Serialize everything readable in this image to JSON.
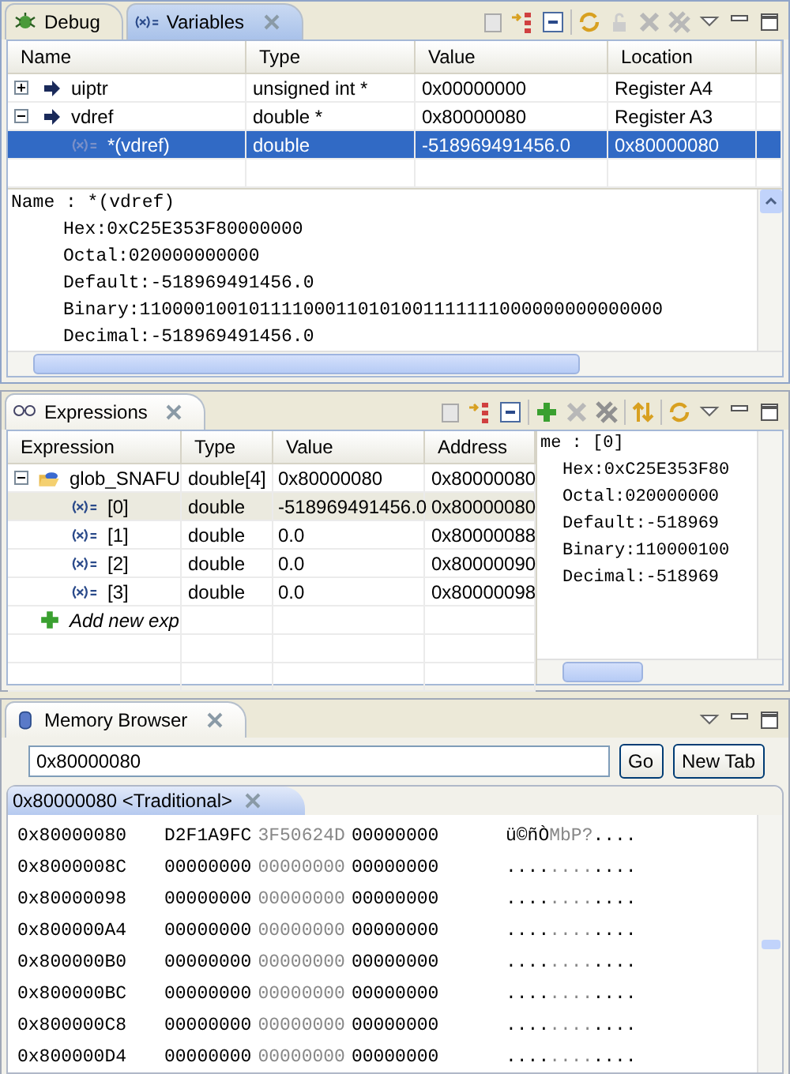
{
  "top_panel": {
    "tabs": [
      {
        "label": "Debug",
        "selected": false,
        "closable": false
      },
      {
        "label": "Variables",
        "selected": true,
        "closable": true
      }
    ]
  },
  "variables": {
    "columns": [
      "Name",
      "Type",
      "Value",
      "Location"
    ],
    "rows": [
      {
        "kind": "pointer",
        "name": "uiptr",
        "type": "unsigned int *",
        "value": "0x00000000",
        "location": "Register A4",
        "expanded": false,
        "selected": false
      },
      {
        "kind": "pointer",
        "name": "vdref",
        "type": "double *",
        "value": "0x80000080",
        "location": "Register A3",
        "expanded": true,
        "selected": false,
        "children": [
          {
            "kind": "variable",
            "name": "*(vdref)",
            "type": "double",
            "value": "-518969491456.0",
            "location": "0x80000080",
            "selected": true
          }
        ]
      }
    ],
    "detail": {
      "name_line": "Name : *(vdref)",
      "lines": [
        "Hex:0xC25E353F80000000",
        "Octal:020000000000",
        "Default:-518969491456.0",
        "Binary:110000100101111000110101001111111000000000000000",
        "Decimal:-518969491456.0"
      ]
    }
  },
  "expressions_panel": {
    "tabs": [
      {
        "label": "Expressions",
        "selected": true,
        "closable": true
      }
    ]
  },
  "expressions": {
    "columns": [
      "Expression",
      "Type",
      "Value",
      "Address"
    ],
    "rows": [
      {
        "kind": "folder",
        "name": "glob_SNAFU",
        "type": "double[4]",
        "value": "0x80000080",
        "location": "0x80000080",
        "expanded": true,
        "selected": false,
        "children": [
          {
            "kind": "variable",
            "name": "[0]",
            "type": "double",
            "value": "-518969491456.0",
            "location": "0x80000080",
            "selected": true
          },
          {
            "kind": "variable",
            "name": "[1]",
            "type": "double",
            "value": "0.0",
            "location": "0x80000088",
            "selected": false
          },
          {
            "kind": "variable",
            "name": "[2]",
            "type": "double",
            "value": "0.0",
            "location": "0x80000090",
            "selected": false
          },
          {
            "kind": "variable",
            "name": "[3]",
            "type": "double",
            "value": "0.0",
            "location": "0x80000098",
            "selected": false
          }
        ]
      }
    ],
    "add_row": "Add new exp",
    "detail": {
      "name_line": "me : [0]",
      "lines": [
        "Hex:0xC25E353F80",
        "Octal:020000000",
        "Default:-518969",
        "Binary:110000100",
        "Decimal:-518969"
      ]
    }
  },
  "memory_panel": {
    "tabs": [
      {
        "label": "Memory Browser",
        "selected": true,
        "closable": true
      }
    ]
  },
  "memory": {
    "address_value": "0x80000080",
    "go_button": "Go",
    "new_tab_button": "New Tab",
    "rendering_tab": {
      "label": "0x80000080 <Traditional>",
      "selected": true
    },
    "rows": [
      {
        "address": "0x80000080",
        "words": [
          "D2F1A9FC",
          "3F50624D",
          "00000000"
        ],
        "ascii": [
          "ü©ñÒ",
          "MbP?",
          "...."
        ]
      },
      {
        "address": "0x8000008C",
        "words": [
          "00000000",
          "00000000",
          "00000000"
        ],
        "ascii": [
          "....",
          "....",
          "...."
        ]
      },
      {
        "address": "0x80000098",
        "words": [
          "00000000",
          "00000000",
          "00000000"
        ],
        "ascii": [
          "....",
          "....",
          "...."
        ]
      },
      {
        "address": "0x800000A4",
        "words": [
          "00000000",
          "00000000",
          "00000000"
        ],
        "ascii": [
          "....",
          "....",
          "...."
        ]
      },
      {
        "address": "0x800000B0",
        "words": [
          "00000000",
          "00000000",
          "00000000"
        ],
        "ascii": [
          "....",
          "....",
          "...."
        ]
      },
      {
        "address": "0x800000BC",
        "words": [
          "00000000",
          "00000000",
          "00000000"
        ],
        "ascii": [
          "....",
          "....",
          "...."
        ]
      },
      {
        "address": "0x800000C8",
        "words": [
          "00000000",
          "00000000",
          "00000000"
        ],
        "ascii": [
          "....",
          "....",
          "...."
        ]
      },
      {
        "address": "0x800000D4",
        "words": [
          "00000000",
          "00000000",
          "00000000"
        ],
        "ascii": [
          "....",
          "....",
          "...."
        ]
      }
    ]
  }
}
